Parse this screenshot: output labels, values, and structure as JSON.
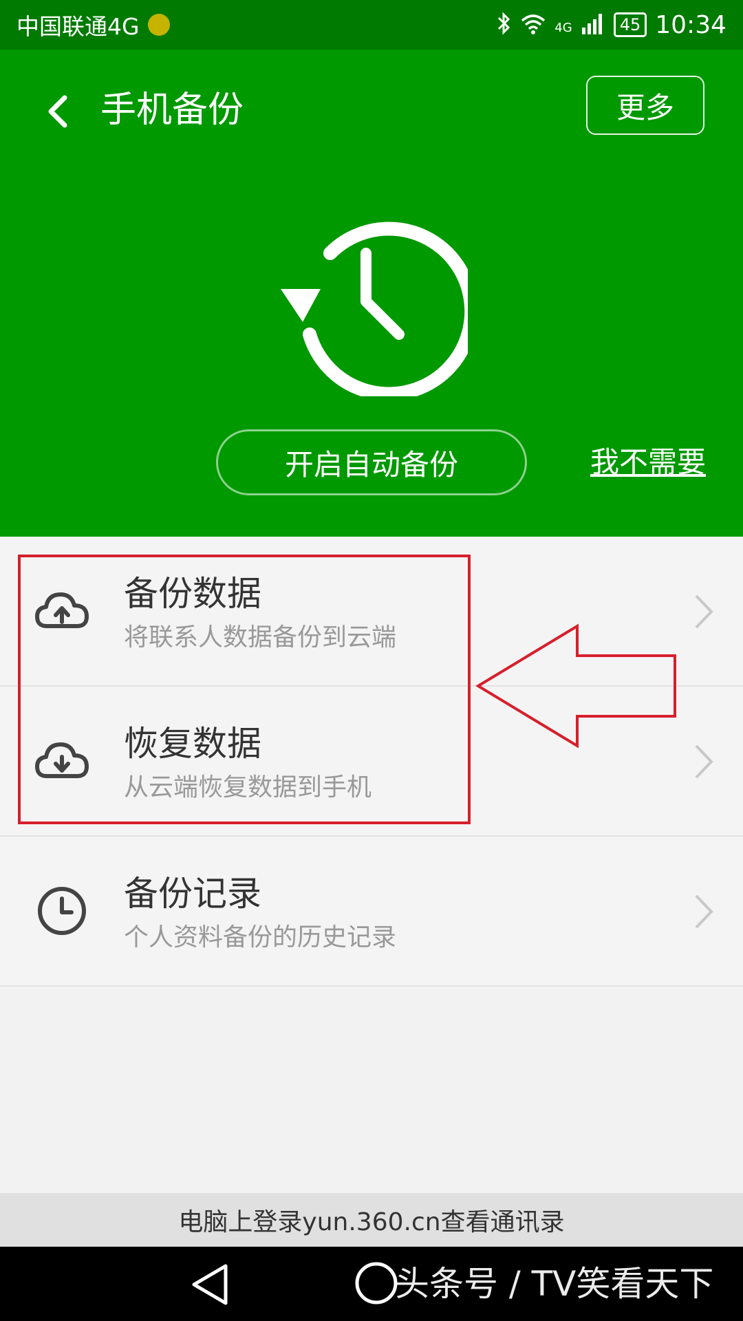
{
  "status_bar": {
    "carrier": "中国联通4G",
    "network_badge": "4G",
    "battery": "45",
    "time": "10:34",
    "icons": [
      "bluetooth-icon",
      "wifi-icon",
      "signal-icon",
      "battery-icon"
    ]
  },
  "header": {
    "title": "手机备份",
    "more_label": "更多",
    "auto_backup_label": "开启自动备份",
    "skip_label": "我不需要",
    "color": "#009900"
  },
  "list": {
    "items": [
      {
        "title": "备份数据",
        "subtitle": "将联系人数据备份到云端",
        "icon": "cloud-upload-icon"
      },
      {
        "title": "恢复数据",
        "subtitle": "从云端恢复数据到手机",
        "icon": "cloud-download-icon"
      },
      {
        "title": "备份记录",
        "subtitle": "个人资料备份的历史记录",
        "icon": "clock-icon"
      }
    ]
  },
  "footer": {
    "banner_text": "电脑上登录yun.360.cn查看通讯录"
  },
  "watermark": {
    "text": "头条号 / TV笑看天下"
  },
  "colors": {
    "annotation": "#d61f2c"
  }
}
